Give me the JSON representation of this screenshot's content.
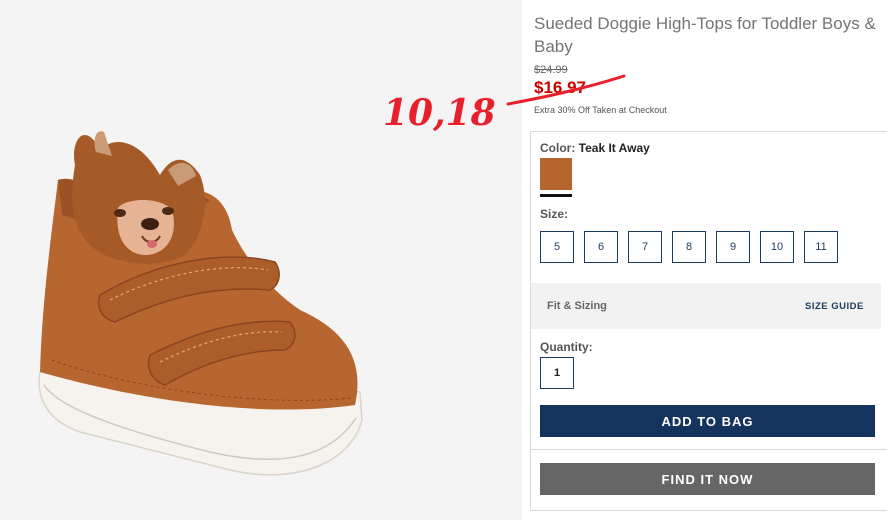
{
  "product": {
    "title": "Sueded Doggie High-Tops for Toddler Boys & Baby",
    "original_price": "$24.99",
    "sale_price": "$16.97",
    "promo": "Extra 30% Off Taken at Checkout",
    "handwritten_note": "10,18"
  },
  "color": {
    "label": "Color:",
    "value": "Teak It Away",
    "swatch_color": "#b7652f"
  },
  "size": {
    "label": "Size:",
    "options": [
      "5",
      "6",
      "7",
      "8",
      "9",
      "10",
      "11"
    ]
  },
  "fit": {
    "label": "Fit & Sizing",
    "guide_link": "SIZE GUIDE"
  },
  "quantity": {
    "label": "Quantity:",
    "value": "1"
  },
  "actions": {
    "add_to_bag": "ADD TO BAG",
    "find_it_now": "FIND IT NOW"
  },
  "colors": {
    "accent_navy": "#14345e",
    "sale_red": "#cc0000",
    "annotation_red": "#e8202c",
    "find_gray": "#666666"
  }
}
